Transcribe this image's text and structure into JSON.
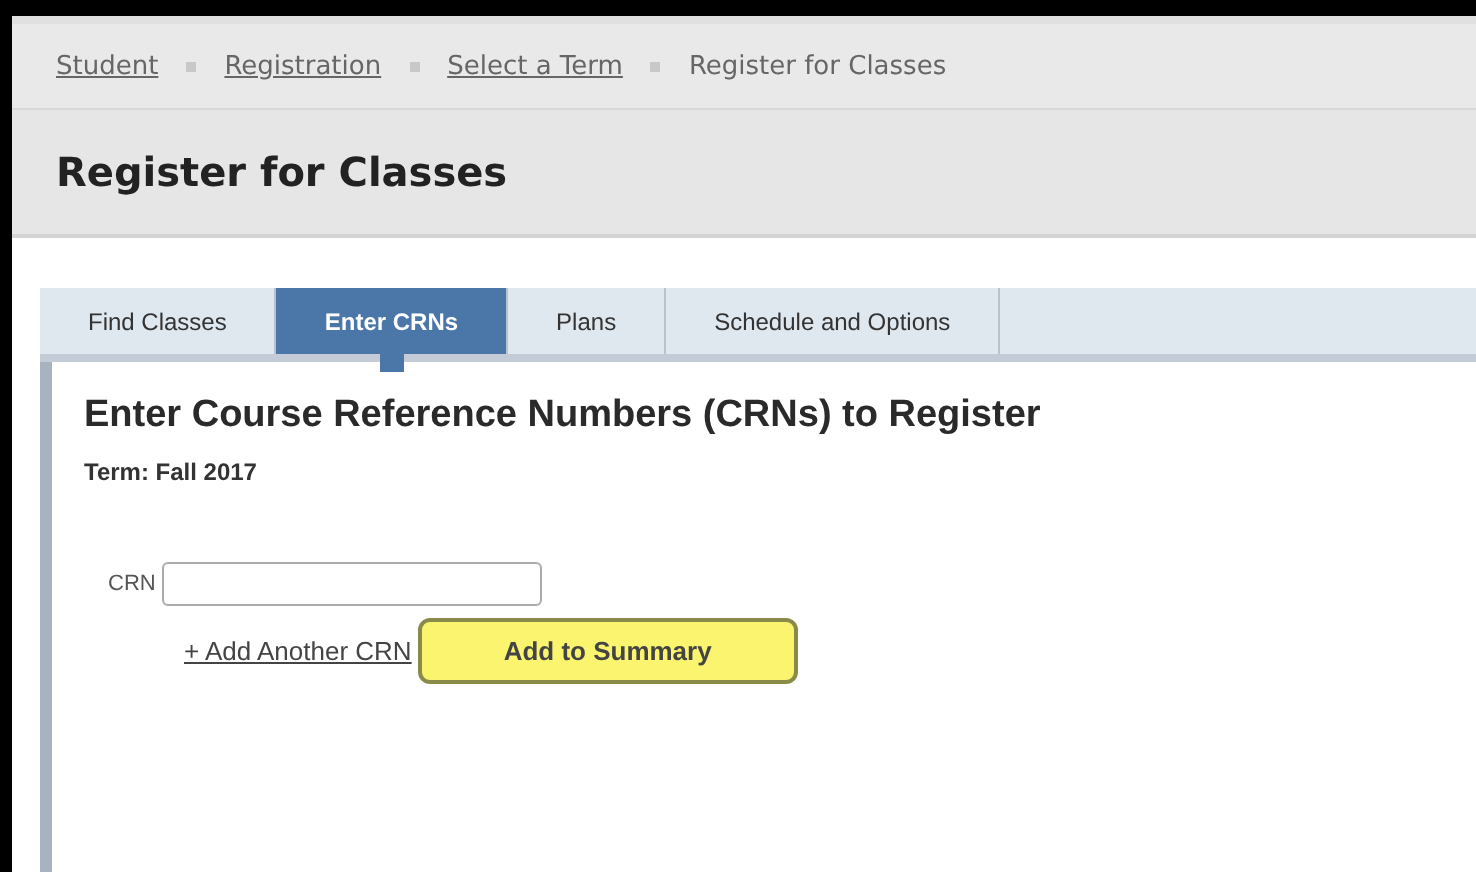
{
  "breadcrumbs": [
    {
      "label": "Student",
      "link": true
    },
    {
      "label": "Registration",
      "link": true
    },
    {
      "label": "Select a Term",
      "link": true
    },
    {
      "label": "Register for Classes",
      "link": false
    }
  ],
  "page_title": "Register for Classes",
  "tabs": [
    {
      "label": "Find Classes",
      "selected": false
    },
    {
      "label": "Enter CRNs",
      "selected": true
    },
    {
      "label": "Plans",
      "selected": false
    },
    {
      "label": "Schedule and Options",
      "selected": false
    }
  ],
  "panel": {
    "heading": "Enter Course Reference Numbers (CRNs) to Register",
    "term": "Term: Fall 2017",
    "crn_label": "CRN",
    "add_link": "+ Add Another CRN",
    "submit_button": "Add to Summary"
  }
}
